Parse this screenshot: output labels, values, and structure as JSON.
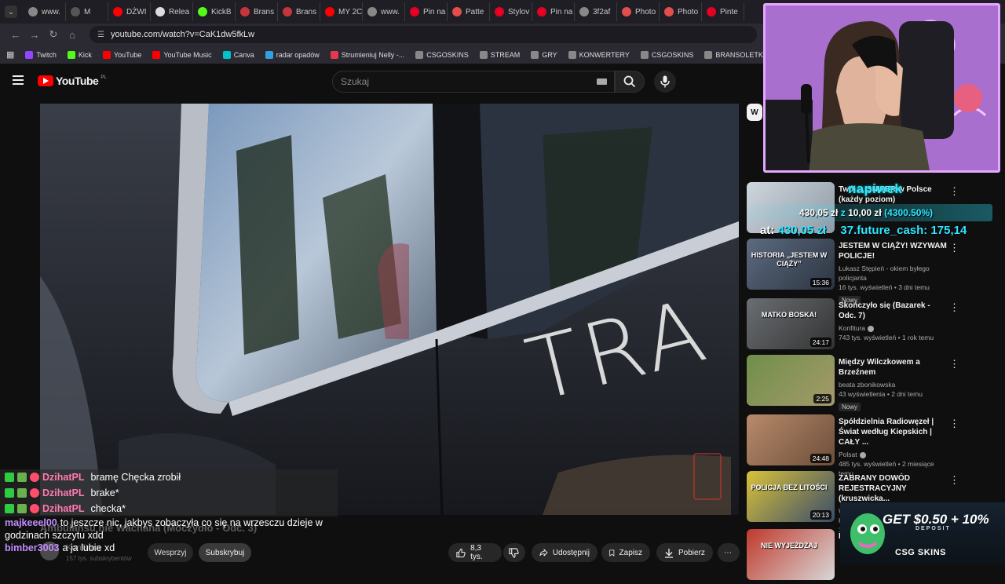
{
  "browser": {
    "tabs": [
      {
        "label": "www.",
        "color": "#888888"
      },
      {
        "label": "M",
        "color": "#555555"
      },
      {
        "label": "DŻWI",
        "color": "#ff0000"
      },
      {
        "label": "Relea",
        "color": "#dddddd"
      },
      {
        "label": "KickB",
        "color": "#53fc18"
      },
      {
        "label": "Brans",
        "color": "#c7353b"
      },
      {
        "label": "Brans",
        "color": "#c7353b"
      },
      {
        "label": "MY 2C",
        "color": "#ff0000"
      },
      {
        "label": "www.",
        "color": "#888888"
      },
      {
        "label": "Pin na",
        "color": "#e60023"
      },
      {
        "label": "Patte",
        "color": "#e34d4d"
      },
      {
        "label": "Stylov",
        "color": "#e60023"
      },
      {
        "label": "Pin na",
        "color": "#e60023"
      },
      {
        "label": "3f2af",
        "color": "#888888"
      },
      {
        "label": "Photo",
        "color": "#e34d4d"
      },
      {
        "label": "Photo",
        "color": "#e34d4d"
      },
      {
        "label": "Pinte",
        "color": "#e60023"
      }
    ],
    "url": "youtube.com/watch?v=CaK1dw5fkLw",
    "bookmarks": [
      {
        "label": "Twitch",
        "color": "#9146ff"
      },
      {
        "label": "Kick",
        "color": "#53fc18"
      },
      {
        "label": "YouTube",
        "color": "#ff0000"
      },
      {
        "label": "YouTube Music",
        "color": "#ff0000"
      },
      {
        "label": "Canva",
        "color": "#00c4cc"
      },
      {
        "label": "radar opadów",
        "color": "#33a0e0"
      },
      {
        "label": "Strumieniuj Nelly -...",
        "color": "#e63950"
      },
      {
        "label": "CSGOSKINS",
        "color": "#888888"
      },
      {
        "label": "STREAM",
        "color": "#888888"
      },
      {
        "label": "GRY",
        "color": "#888888"
      },
      {
        "label": "KONWERTERY",
        "color": "#888888"
      },
      {
        "label": "CSGOSKINS",
        "color": "#888888"
      },
      {
        "label": "BRANSOLETKI",
        "color": "#888888"
      },
      {
        "label": "Ustawienia strumien...",
        "color": "#9146ff"
      }
    ]
  },
  "header": {
    "logo_text": "YouTube",
    "country": "PL",
    "search_placeholder": "Szukaj"
  },
  "video": {
    "door_text": "TRA",
    "title": "Ambulansu nie Wachana (Moczydło - Odc. 3)",
    "channel": "Konfitura",
    "subscribers": "157 tys. subskrybentów",
    "support_label": "Wesprzyj",
    "subscribe_label": "Subskrybuj",
    "likes": "8,3 tys.",
    "share_label": "Udostępnij",
    "save_label": "Zapisz",
    "download_label": "Pobierz"
  },
  "chat": [
    {
      "user": "DzihatPL",
      "msg": "bramę Chęcka zrobił",
      "color": "#ff7ab0",
      "badges": true
    },
    {
      "user": "DzihatPL",
      "msg": "brake*",
      "color": "#ff7ab0",
      "badges": true
    },
    {
      "user": "DzihatPL",
      "msg": "checka*",
      "color": "#ff7ab0",
      "badges": true
    },
    {
      "user": "majkeeel00",
      "msg": "to jeszcze nic, jakbys zobaczyła co się na wrzesczu dzieje w godzinach szczytu xdd",
      "color": "#c28cff",
      "badges": false
    },
    {
      "user": "bimber3003",
      "msg": "a ja lubie xd",
      "color": "#c28cff",
      "badges": false
    }
  ],
  "sidebar": {
    "chip": "W",
    "recommendations": [
      {
        "title": "Twój ... SNIPER w Polsce (każdy poziom)",
        "channel": "",
        "views": "",
        "age": "",
        "duration": "",
        "is_new": false,
        "thumb": "bez"
      },
      {
        "title": "JESTEM W CIĄŻY! WZYWAM POLICJE!",
        "channel": "Łukasz Stępień - okiem byłego policjanta",
        "views": "16 tys. wyświetleń",
        "age": "3 dni temu",
        "duration": "15:36",
        "is_new": true,
        "thumb_text": "HISTORIA „JESTEM W CIĄŻY”",
        "thumb": "car"
      },
      {
        "title": "Skończyło się (Bazarek - Odc. 7)",
        "channel": "Konfitura",
        "views": "743 tys. wyświetleń",
        "age": "1 rok temu",
        "duration": "24:17",
        "is_new": false,
        "verified": true,
        "thumb_text": "MATKO BOSKA!",
        "thumb": "car2"
      },
      {
        "title": "Między Wilczkowem a Brzeźnem",
        "channel": "beata zbonikowska",
        "views": "43 wyświetlenia",
        "age": "2 dni temu",
        "duration": "2:25",
        "is_new": true,
        "thumb": "field"
      },
      {
        "title": "Spółdzielnia Radiowęzeł | Świat według Kiepskich | CAŁY ...",
        "channel": "Polsat",
        "views": "485 tys. wyświetleń",
        "age": "2 miesiące temu",
        "duration": "24:48",
        "is_new": false,
        "verified": true,
        "thumb": "man"
      },
      {
        "title": "ZABRANY DOWÓD REJESTRACYJNY (kruszwicka...",
        "channel": "Wolne Chodniki - Edukujemy Kierowców",
        "views": "10",
        "age": "",
        "duration": "20:13",
        "is_new": false,
        "thumb_text": "POLICJA BEZ LITOŚCI",
        "thumb": "police"
      },
      {
        "title": "Ko...",
        "channel": "",
        "views": "",
        "age": "",
        "duration": "",
        "is_new": false,
        "thumb_text": "NIE WYJEŻDŻAJ",
        "thumb": "last"
      }
    ]
  },
  "overlays": {
    "tip_title": "napiwek",
    "tip_amount": "430,05 zł",
    "tip_of": "z",
    "tip_goal": "10,00 zł",
    "tip_percent": "(4300.50%)",
    "ticker_prefix": "at:",
    "ticker_amount": "430,05 zł",
    "ticker_user": "37.future_cash:",
    "ticker_amount2": "175,14",
    "ad_headline": "GET $0.50 + 10%",
    "ad_sub": "DEPOSIT",
    "ad_brand": "CSG SKINS"
  }
}
